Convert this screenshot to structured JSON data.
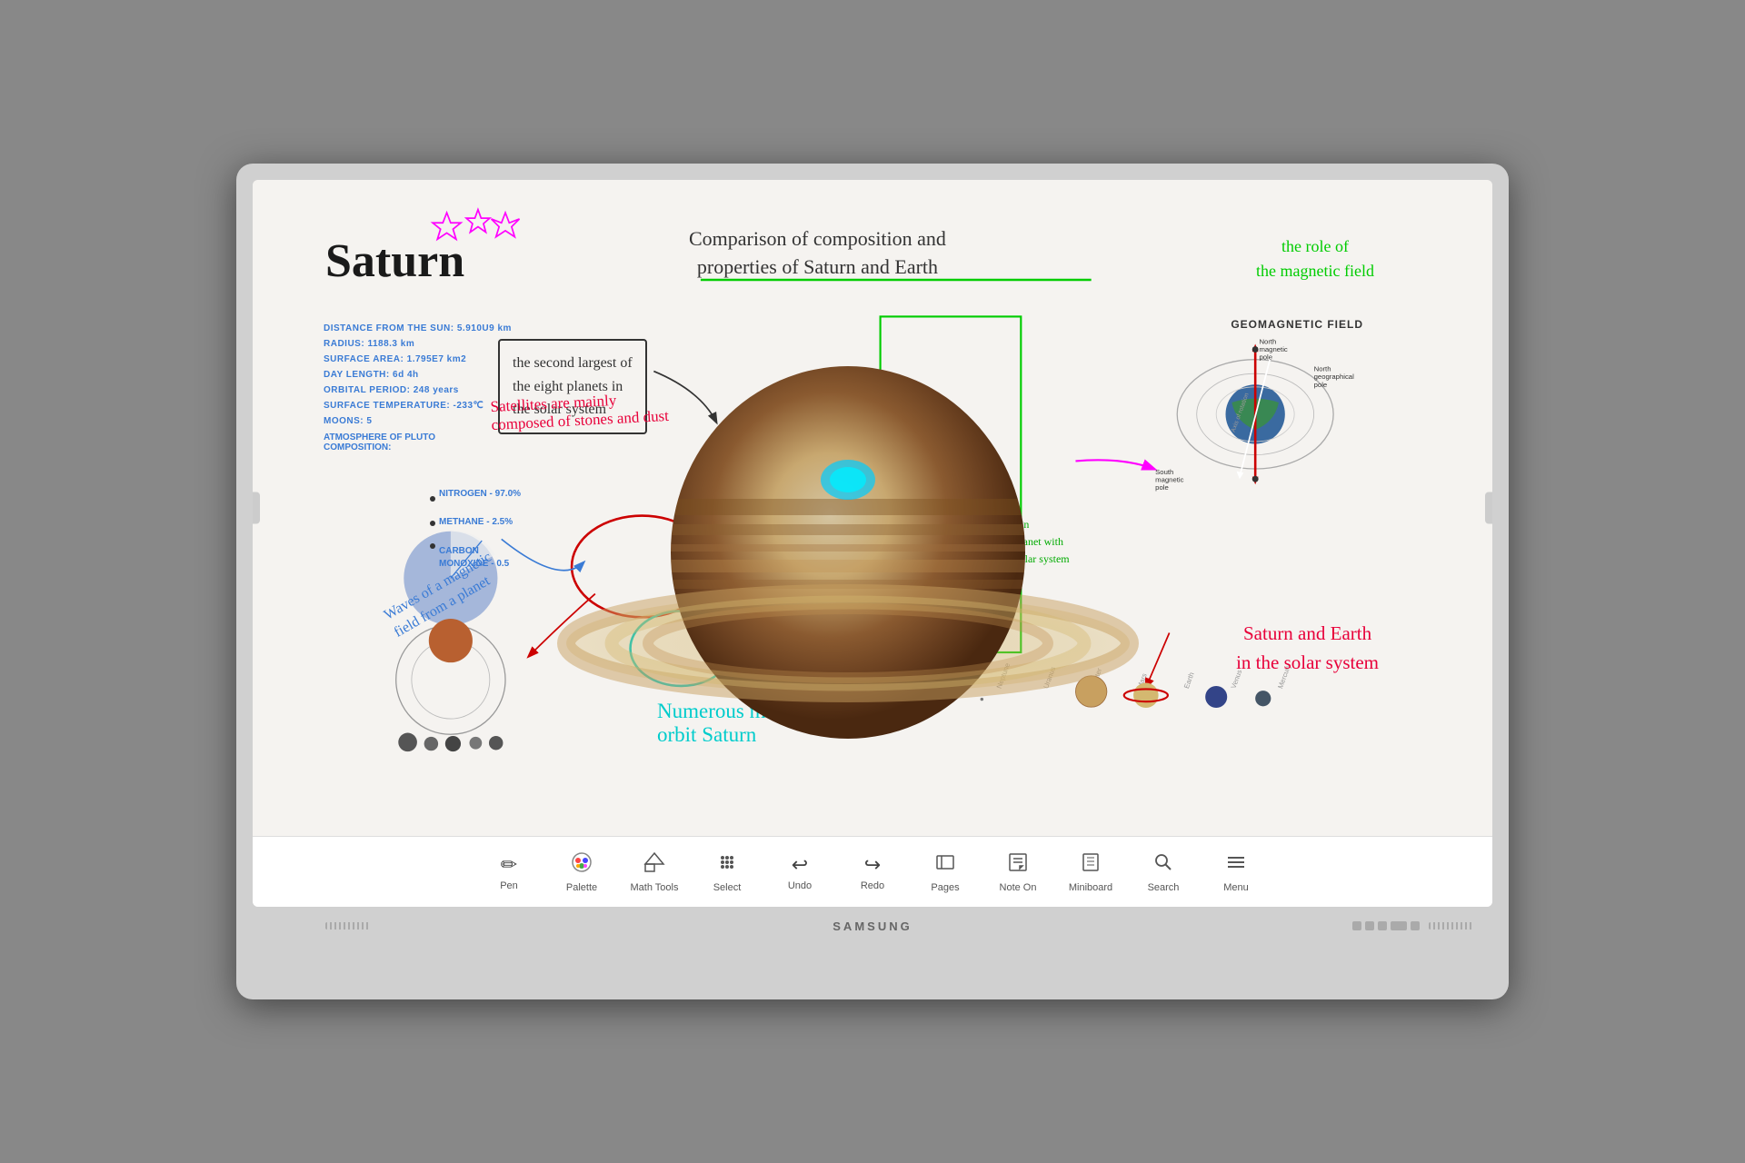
{
  "monitor": {
    "brand": "SAMSUNG"
  },
  "header": {
    "title": "Saturn",
    "comparison_title": "Comparison of composition and\nproperties of Saturn and Earth",
    "magnetic_role": "the role of\nthe magnetic field"
  },
  "info": {
    "distance": "DISTANCE FROM THE SUN: 5.910U9 km",
    "radius": "RADIUS: 1188.3 km",
    "surface_area": "SURFACE AREA: 1.795E7 km2",
    "day_length": "DAY LENGTH: 6d  4h",
    "orbital_period": "ORBITAL PERIOD: 248 years",
    "surface_temp": "SURFACE TEMPERATURE: -233℃",
    "moons": "MOONS: 5"
  },
  "atmosphere": {
    "title": "ATMOSPHERE OF PLUTO",
    "composition_label": "COMPOSITION:",
    "nitrogen": "NITROGEN - 97.0%",
    "methane": "METHANE - 2.5%",
    "carbon_monoxide": "CARBON\nMONOXIDE - 0.5"
  },
  "annotations": {
    "second_largest": "the second largest of\nthe eight planets in\nthe solar system",
    "satellites": "Satellites are mainly\ncomposed of stones and dust",
    "waves": "Waves of a magnetic\nfield from a planet",
    "numerous_moons": "Numerous moons\norbit Saturn",
    "saturn_earth": "Saturn and Earth\nin the solar system",
    "second_largest_green": "The second largest planet in\nthe solar system and the planet with\nthe most satellites in the solar system"
  },
  "geomagnetic": {
    "title": "GEOMAGNETIC FIELD",
    "north_magnetic": "North\nmagnetic\npole",
    "north_geo": "North\ngeographical\npole",
    "south_magnetic": "South\nmagnetic\npole",
    "axis_label": "Axis of rotation"
  },
  "toolbar": {
    "items": [
      {
        "id": "pen",
        "label": "Pen",
        "icon": "✏️"
      },
      {
        "id": "palette",
        "label": "Palette",
        "icon": "🎨"
      },
      {
        "id": "math-tools",
        "label": "Math Tools",
        "icon": "📐"
      },
      {
        "id": "select",
        "label": "Select",
        "icon": "⊞"
      },
      {
        "id": "undo",
        "label": "Undo",
        "icon": "↩"
      },
      {
        "id": "redo",
        "label": "Redo",
        "icon": "↪"
      },
      {
        "id": "pages",
        "label": "Pages",
        "icon": "▭"
      },
      {
        "id": "note-on",
        "label": "Note On",
        "icon": "📝"
      },
      {
        "id": "miniboard",
        "label": "Miniboard",
        "icon": "📄"
      },
      {
        "id": "search",
        "label": "Search",
        "icon": "🔍"
      },
      {
        "id": "menu",
        "label": "Menu",
        "icon": "☰"
      }
    ]
  }
}
